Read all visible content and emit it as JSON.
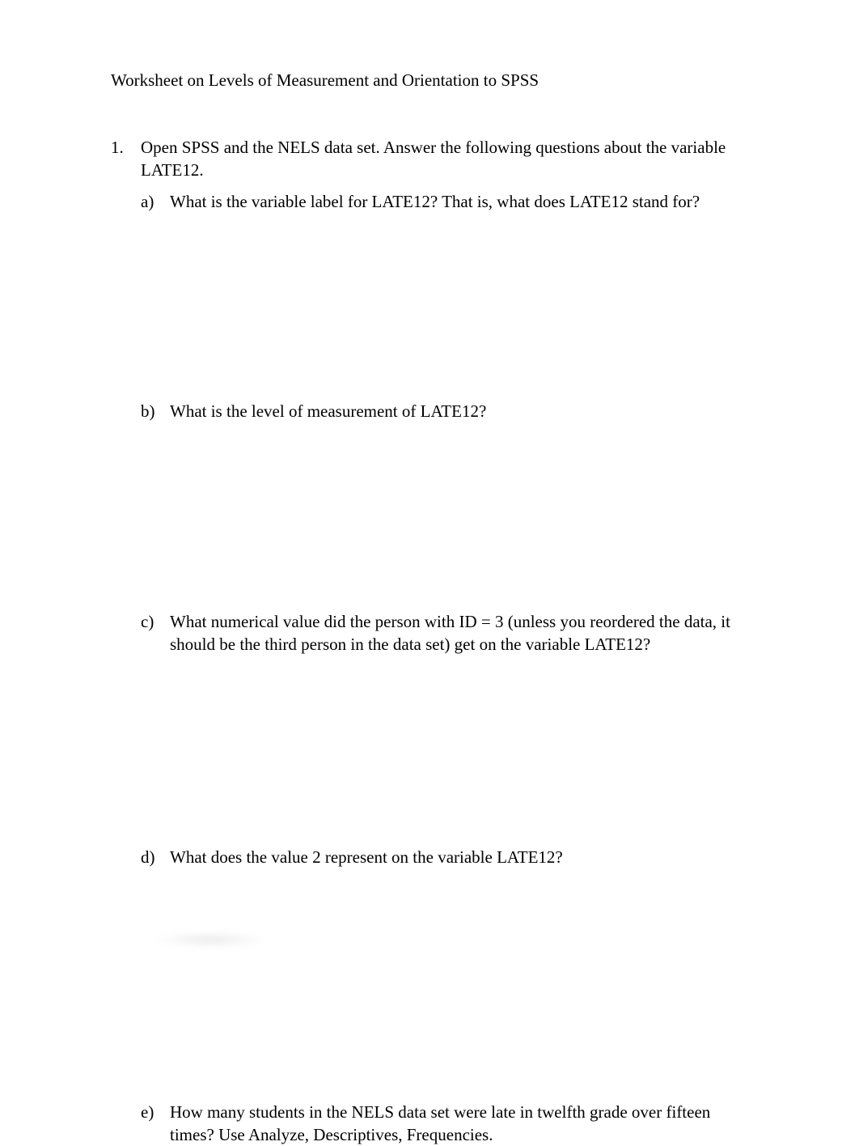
{
  "title": "Worksheet on Levels of Measurement and Orientation to SPSS",
  "q1": {
    "num": "1.",
    "text": "Open SPSS and the NELS data set.  Answer the following questions about the variable LATE12."
  },
  "a": {
    "letter": "a)",
    "text": "What is the variable label for LATE12?  That is, what does LATE12 stand for?"
  },
  "b": {
    "letter": "b)",
    "text": "What is the level of measurement of LATE12?"
  },
  "c": {
    "letter": "c)",
    "text": "What numerical value did the person with ID = 3 (unless you reordered the data, it should be the third person in the data set) get on the variable LATE12?"
  },
  "d": {
    "letter": "d)",
    "text": "What does the value 2 represent on the variable LATE12?"
  },
  "e": {
    "letter": "e)",
    "text": "How many students in the NELS data set were late in twelfth grade over fifteen times?  Use Analyze, Descriptives, Frequencies."
  }
}
